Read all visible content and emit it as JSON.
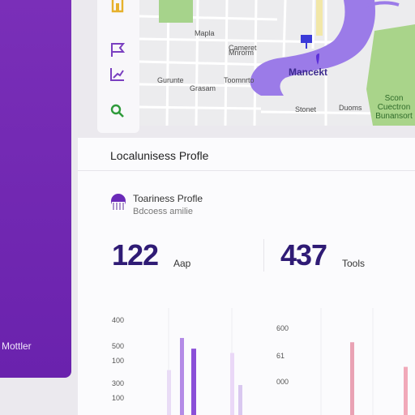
{
  "sidebar": {
    "label": "Mottler"
  },
  "rail": {
    "icons": [
      "shop-icon",
      "flag-icon",
      "chart-icon",
      "search-icon"
    ]
  },
  "map": {
    "labels": [
      "Mapla",
      "Cameret",
      "Gurunte",
      "Grasam",
      "Toomnrto",
      "Mnrorm",
      "Stonet",
      "Duoms"
    ],
    "place_name": "Mancekt",
    "park": "Scon\nCuectron\nBunansort"
  },
  "card": {
    "title": "Localunisess Profle",
    "profile": {
      "name": "Toariness Profle",
      "subtitle": "Bdcoess amilie"
    }
  },
  "stats": [
    {
      "value": "122",
      "unit": "Aap"
    },
    {
      "value": "437",
      "unit": "Tools"
    }
  ],
  "chart_data": [
    {
      "type": "bar",
      "y_ticks": [
        "400",
        "500",
        "100",
        "300",
        "100"
      ],
      "series": [
        {
          "values": [
            0.62,
            0.58,
            0.28,
            0.72,
            0.42
          ]
        }
      ]
    },
    {
      "type": "bar",
      "y_ticks": [
        "600",
        "61",
        "000"
      ],
      "series": [
        {
          "values": [
            0.3,
            0.45,
            0.68
          ]
        }
      ]
    }
  ],
  "colors": {
    "primary": "#6b27ad",
    "accent": "#9b6be8",
    "dark_text": "#2f1b75",
    "park": "#a9d48a",
    "water": "#9b7be8"
  }
}
